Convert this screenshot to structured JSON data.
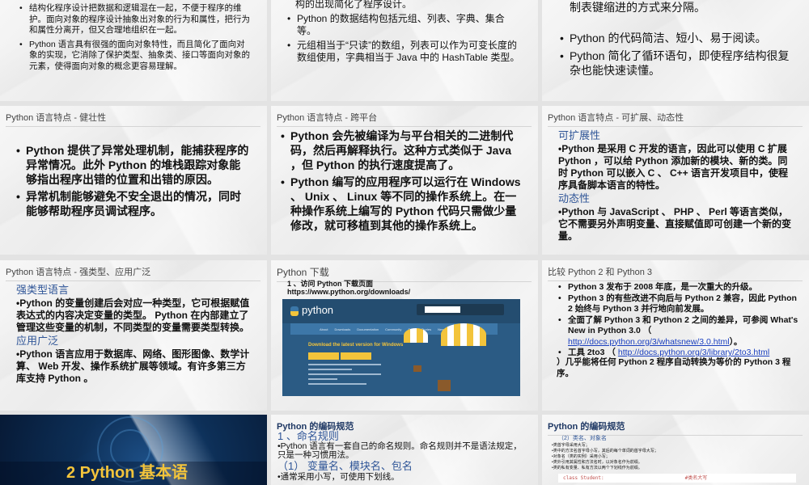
{
  "slides": [
    {
      "bullets": [
        "结构化程序设计把数据和逻辑混在一起，不便于程序的维护。面向对象的程序设计抽象出对象的行为和属性，把行为和属性分离开，但又合理地组织在一起。",
        "Python 语言具有很强的面向对象特性，而且简化了面向对象的实现，它消除了保护类型、抽象类、接口等面向对象的元素，使得面向对象的概念更容易理解。"
      ]
    },
    {
      "partial": "构的出现简化了程序设计。",
      "bullets": [
        "Python 的数据结构包括元组、列表、字典、集合等。",
        "元组相当于“只读”的数组，列表可以作为可变长度的数组使用，字典相当于 Java 中的 HashTable 类型。"
      ]
    },
    {
      "partial": "、 begin 、 end 等标记，代码块使用空格或制表键缩进的方式来分隔。",
      "bullets": [
        "Python 的代码简洁、短小、易于阅读。",
        "Python 简化了循环语句，即使程序结构很复杂也能快速读懂。"
      ]
    },
    {
      "title": "Python 语言特点 - 健壮性",
      "bullets": [
        "Python 提供了异常处理机制，能捕获程序的异常情况。此外 Python 的堆栈跟踪对象能够指出程序出错的位置和出错的原因。",
        "异常机制能够避免不安全退出的情况，同时能够帮助程序员调试程序。"
      ]
    },
    {
      "title": "Python 语言特点 - 跨平台",
      "bullets": [
        "Python 会先被编译为与平台相关的二进制代码，然后再解释执行。这种方式类似于 Java ，但 Python 的执行速度提高了。",
        "Python 编写的应用程序可以运行在 Windows 、 Unix 、 Linux 等不同的操作系统上。在一种操作系统上编写的 Python 代码只需做少量修改，就可移植到其他的操作系统上。"
      ]
    },
    {
      "title": "Python 语言特点 - 可扩展、动态性",
      "sub1": "可扩展性",
      "p1": "•Python 是采用 C 开发的语言，因此可以使用 C 扩展 Python ，可以给 Python 添加新的模块、新的类。同时 Python 可以嵌入 C 、 C++ 语言开发项目中，使程序具备脚本语言的特性。",
      "sub2": "动态性",
      "p2": "•Python 与 JavaScript 、 PHP 、 Perl 等语言类似，它不需要另外声明变量、直接赋值即可创建一个新的变量。"
    },
    {
      "title": "Python 语言特点 - 强类型、应用广泛",
      "sub1": "强类型语言",
      "p1": "•Python 的变量创建后会对应一种类型，它可根据赋值表达式的内容决定变量的类型。 Python 在内部建立了管理这些变量的机制，不同类型的变量需要类型转换。",
      "sub2": "应用广泛",
      "p2": "•Python 语言应用于数据库、网络、图形图像、数学计算、 Web 开发、操作系统扩展等领域。有许多第三方库支持 Python 。"
    },
    {
      "title": "Python 下载",
      "step": "1 、访问 Python 下载页面",
      "url": "https://www.python.org/downloads/",
      "shot": {
        "logo": "python",
        "nav": [
          "About",
          "Downloads",
          "Documentation",
          "Community",
          "Success Stories",
          "News",
          "Events"
        ],
        "headline": "Download the latest version for Windows"
      }
    },
    {
      "title": "比较 Python 2 和 Python 3",
      "b1": "Python 3 发布于 2008 年底，是一次重大的升级。",
      "b2": "Python 3 的有些改进不向后与 Python 2 兼容，因此 Python 2 始终与 Python 3 并行地向前发展。",
      "b3": "全面了解 Python 3 和 Python 2 之间的差异，可参阅 What's New in Python 3.0 （",
      "b3link": "http://docs.python.org/3/whatsnew/3.0.html",
      "b3end": "）。",
      "b4": "工具 2to3 （",
      "b4link": "http://docs.python.org/3/library/2to3.html",
      "b4end": "）几乎能将任何 Python 2 程序自动转换为等价的 Python 3 程序。"
    },
    {
      "title": "2 Python 基本语"
    },
    {
      "title": "Python 的编码规范",
      "sub1": "1 、命名规则",
      "p1": "•Python 语言有一套自己的命名规则。命名规则并不是语法规定，只是一种习惯用法。",
      "sub2": "（1） 变量名、模块名、包名",
      "p2": "•通常采用小写，可使用下划线。"
    },
    {
      "title": "Python 的编码规范",
      "sub1": "（2）类名、对象名",
      "lines": [
        "•类首字母采用大写；",
        "•类中的方法名首字母小写，其后的每个单词的首字母大写；",
        "•对象名（类的实例）采用小写；",
        "•类外引用其属性和方法名时，以对象名作为前缀。",
        "•类的私有变量、私有方法以两个下划线作为前缀。"
      ],
      "code": "class Student:",
      "comment": "#类名大写"
    }
  ]
}
